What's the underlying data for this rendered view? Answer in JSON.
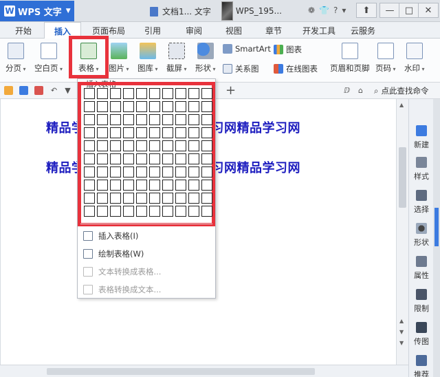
{
  "titlebar": {
    "app_name": "WPS 文字",
    "doc_tab": "文档1... 文字",
    "user_name": "WPS_195...",
    "minimize": "—",
    "restore": "□",
    "close": "✕"
  },
  "menu_tabs": [
    "开始",
    "插入",
    "页面布局",
    "引用",
    "审阅",
    "视图",
    "章节",
    "开发工具",
    "云服务"
  ],
  "ribbon": {
    "page_break": "分页",
    "blank_page": "空白页",
    "table": "表格",
    "picture": "图片",
    "gallery": "图库",
    "screenshot": "截屏",
    "shape": "形状",
    "smartart": "SmartArt",
    "chart": "图表",
    "relation_chart": "关系图",
    "online_chart": "在线图表",
    "header_footer": "页眉和页脚",
    "page_number": "页码",
    "watermark": "水印"
  },
  "quickbar": {
    "search_label": "点此查找命令"
  },
  "document": {
    "line1": "精品学习网精品学习网精品学习网精品学习网",
    "line2": "精品学习网精品学习网精品学习网精品学习网"
  },
  "taskpane": [
    "新建",
    "样式",
    "选择",
    "形状",
    "属性",
    "限制",
    "传图",
    "推荐"
  ],
  "dropdown": {
    "title": "插入表格",
    "grid_rows": 10,
    "grid_cols": 10,
    "insert_table": "插入表格(I)",
    "draw_table": "绘制表格(W)",
    "text_to_table": "文本转换成表格...",
    "table_to_text": "表格转换成文本..."
  },
  "colors": {
    "accent": "#2f6fd6",
    "highlight": "#e8323c",
    "doc_text": "#1d1dbf"
  }
}
